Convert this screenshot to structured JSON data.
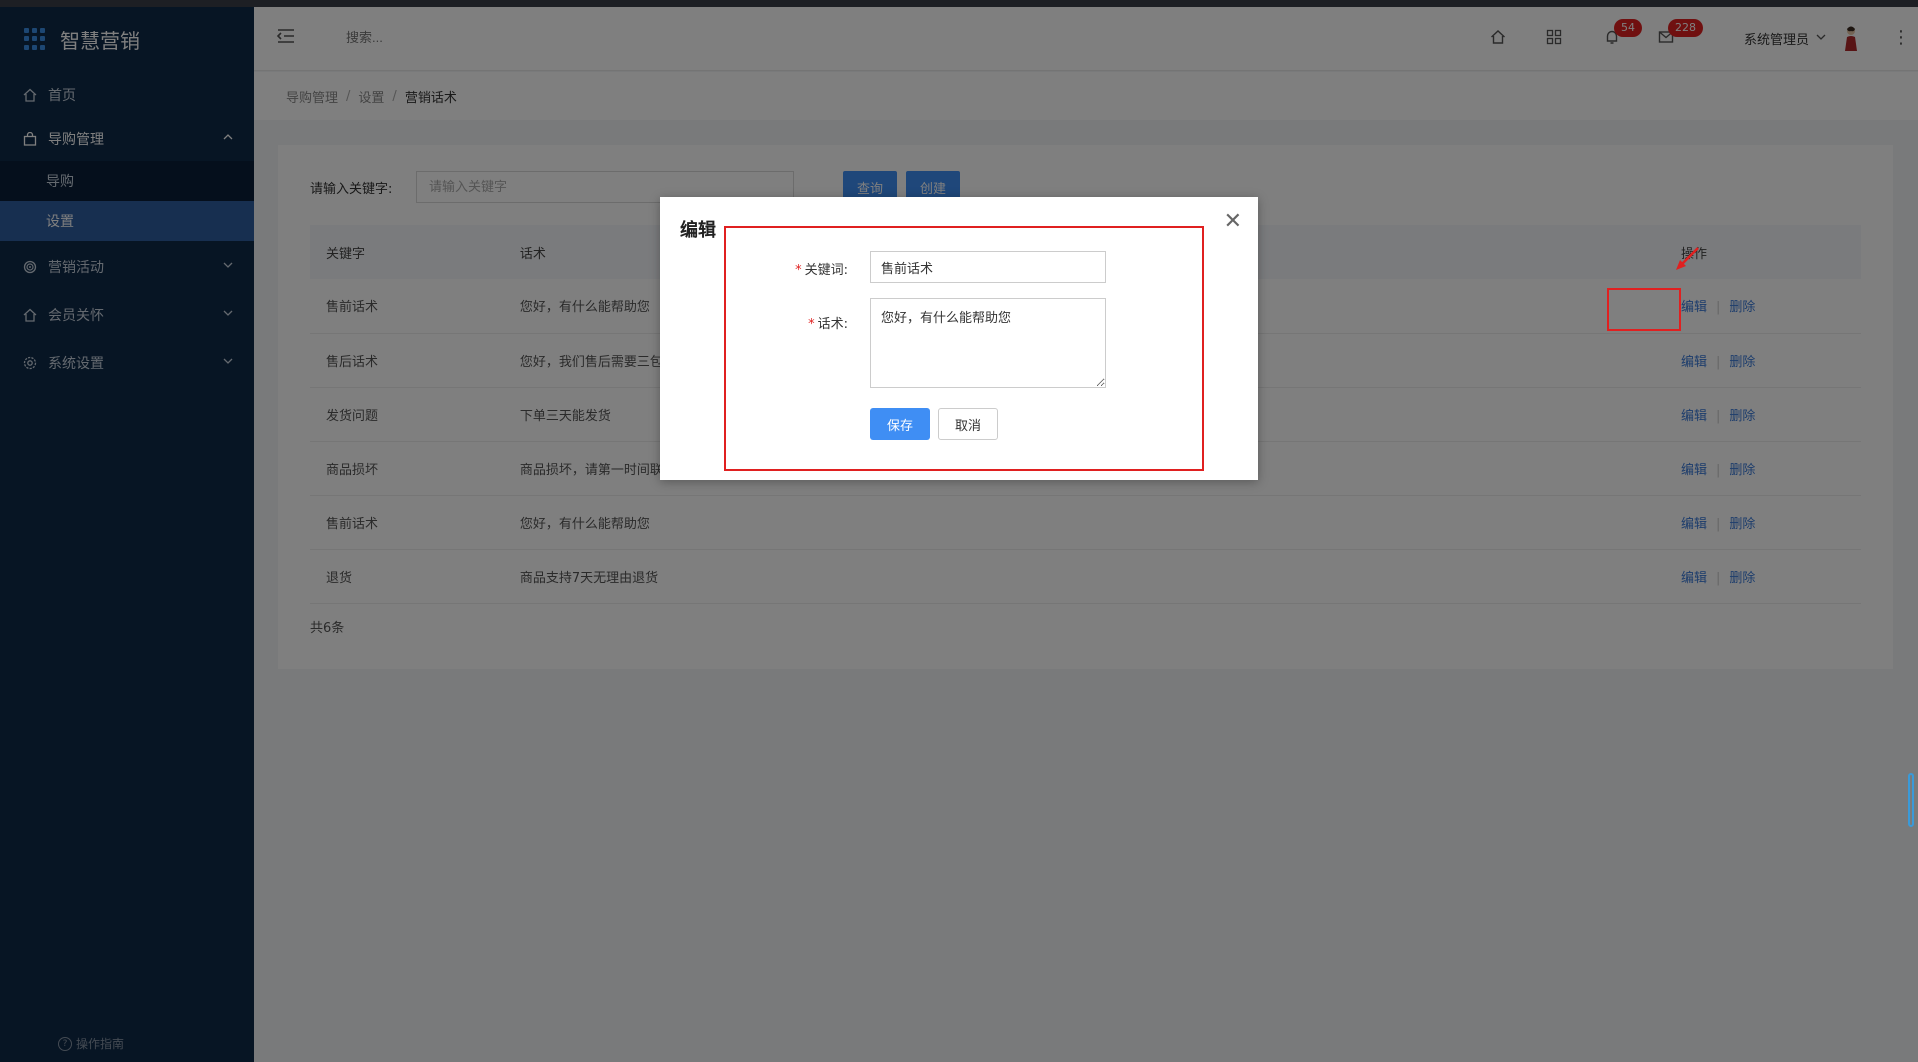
{
  "app": {
    "logo_text": "智慧营销"
  },
  "sidebar": {
    "items": [
      {
        "label": "首页",
        "icon": "home-icon"
      },
      {
        "label": "导购管理",
        "icon": "bag-icon",
        "expanded": true,
        "children": [
          {
            "label": "导购"
          },
          {
            "label": "设置",
            "active": true
          }
        ]
      },
      {
        "label": "营销活动",
        "icon": "target-icon"
      },
      {
        "label": "会员关怀",
        "icon": "home-icon"
      },
      {
        "label": "系统设置",
        "icon": "gear-icon"
      }
    ],
    "guide_label": "操作指南"
  },
  "header": {
    "search_placeholder": "搜索...",
    "notifications_count": "54",
    "messages_count": "228",
    "user_name": "系统管理员"
  },
  "breadcrumb": {
    "items": [
      "导购管理",
      "设置",
      "营销话术"
    ]
  },
  "filter": {
    "label": "请输入关键字:",
    "placeholder": "请输入关键字",
    "query_label": "查询",
    "create_label": "创建"
  },
  "table": {
    "headers": [
      "关键字",
      "话术",
      "操作"
    ],
    "edit_label": "编辑",
    "delete_label": "删除",
    "rows": [
      {
        "keyword": "售前话术",
        "script": "您好，有什么能帮助您"
      },
      {
        "keyword": "售后话术",
        "script": "您好，我们售后需要三包"
      },
      {
        "keyword": "发货问题",
        "script": "下单三天能发货"
      },
      {
        "keyword": "商品损坏",
        "script": "商品损坏，请第一时间联系"
      },
      {
        "keyword": "售前话术",
        "script": "您好，有什么能帮助您"
      },
      {
        "keyword": "退货",
        "script": "商品支持7天无理由退货"
      }
    ],
    "total": "共6条"
  },
  "dialog": {
    "title": "编辑",
    "keyword_label": "关键词:",
    "keyword_value": "售前话术",
    "script_label": "话术:",
    "script_value": "您好，有什么能帮助您",
    "save_label": "保存",
    "cancel_label": "取消"
  },
  "colors": {
    "primary": "#3f8ef4",
    "sidebar_bg": "#0f2a48",
    "highlight": "#e02020"
  }
}
